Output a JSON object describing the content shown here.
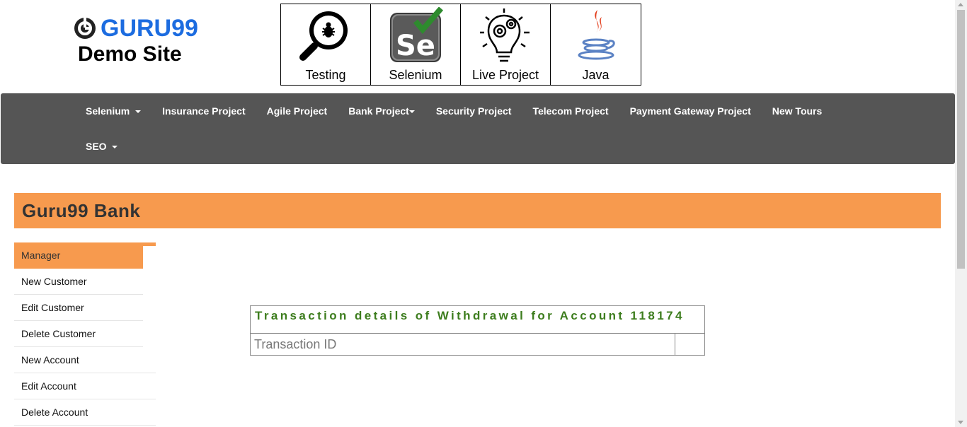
{
  "logo": {
    "brand": "GURU99",
    "subtitle": "Demo Site",
    "brand_color": "#1c6ce0"
  },
  "top_links": [
    {
      "label": "Testing",
      "icon": "magnifier-bug-icon"
    },
    {
      "label": "Selenium",
      "icon": "selenium-logo-icon"
    },
    {
      "label": "Live Project",
      "icon": "lightbulb-gears-icon"
    },
    {
      "label": "Java",
      "icon": "java-coffee-icon"
    }
  ],
  "nav": {
    "row1": [
      {
        "label": "Selenium",
        "dropdown": true
      },
      {
        "label": "Insurance Project",
        "dropdown": false
      },
      {
        "label": "Agile Project",
        "dropdown": false
      },
      {
        "label": "Bank Project",
        "dropdown": true
      },
      {
        "label": "Security Project",
        "dropdown": false
      },
      {
        "label": "Telecom Project",
        "dropdown": false
      },
      {
        "label": "Payment Gateway Project",
        "dropdown": false
      },
      {
        "label": "New Tours",
        "dropdown": false
      }
    ],
    "row2": [
      {
        "label": "SEO",
        "dropdown": true
      }
    ],
    "background": "#555555"
  },
  "bank": {
    "title": "Guru99 Bank",
    "accent": "#f79a4e"
  },
  "menu": {
    "items": [
      "Manager",
      "New Customer",
      "Edit Customer",
      "Delete Customer",
      "New Account",
      "Edit Account",
      "Delete Account"
    ],
    "active": "Manager"
  },
  "transaction": {
    "heading": "Transaction details of Withdrawal for Account 118174",
    "heading_color": "#3d7d1e",
    "rows": [
      {
        "label": "Transaction ID",
        "value": ""
      }
    ]
  }
}
